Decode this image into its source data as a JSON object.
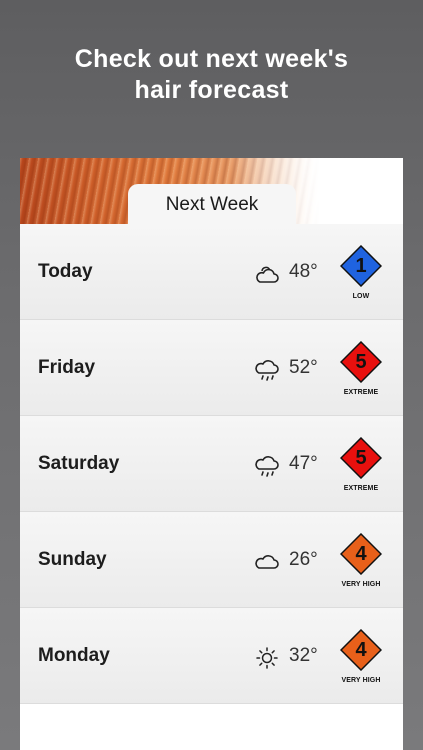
{
  "headline": {
    "line1": "Check out next week's",
    "line2": "hair forecast"
  },
  "tab": {
    "label": "Next Week"
  },
  "forecast": [
    {
      "day": "Today",
      "icon": "partly-cloudy-icon",
      "temp": "48°",
      "level": "1",
      "risk": "LOW",
      "color": "#1f63e0"
    },
    {
      "day": "Friday",
      "icon": "rain-cloud-icon",
      "temp": "52°",
      "level": "5",
      "risk": "EXTREME",
      "color": "#e8100e"
    },
    {
      "day": "Saturday",
      "icon": "rain-cloud-icon",
      "temp": "47°",
      "level": "5",
      "risk": "EXTREME",
      "color": "#e8100e"
    },
    {
      "day": "Sunday",
      "icon": "cloud-icon",
      "temp": "26°",
      "level": "4",
      "risk": "VERY HIGH",
      "color": "#e8601a"
    },
    {
      "day": "Monday",
      "icon": "sun-icon",
      "temp": "32°",
      "level": "4",
      "risk": "VERY HIGH",
      "color": "#e8601a"
    }
  ]
}
